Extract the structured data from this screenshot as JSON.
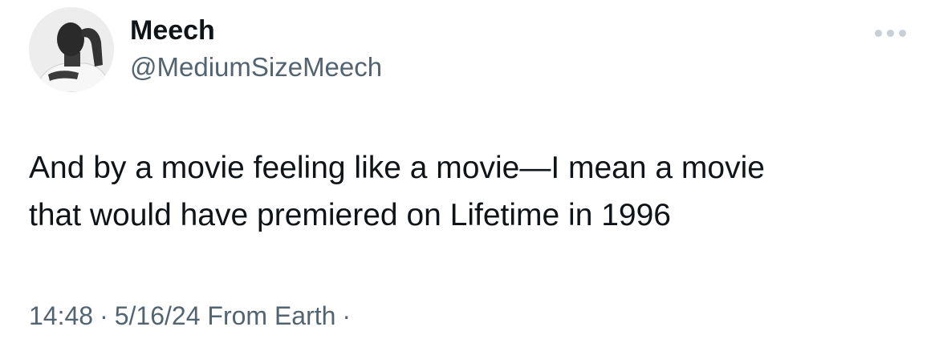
{
  "author": {
    "display_name": "Meech",
    "handle": "@MediumSizeMeech",
    "avatar_icon": "profile-photo"
  },
  "actions": {
    "more_icon": "more-horizontal-icon"
  },
  "tweet": {
    "text_line_1": "And by a movie feeling like a movie—I mean a movie",
    "text_line_2": "that would have premiered on Lifetime in 1996"
  },
  "meta": {
    "time": "14:48",
    "separator": "·",
    "date": "5/16/24",
    "source": "From Earth",
    "trailing_separator": "·"
  },
  "colors": {
    "primary_text": "#0f1419",
    "secondary_text": "#536471",
    "more_dots": "#c8cfd6",
    "background": "#ffffff"
  }
}
